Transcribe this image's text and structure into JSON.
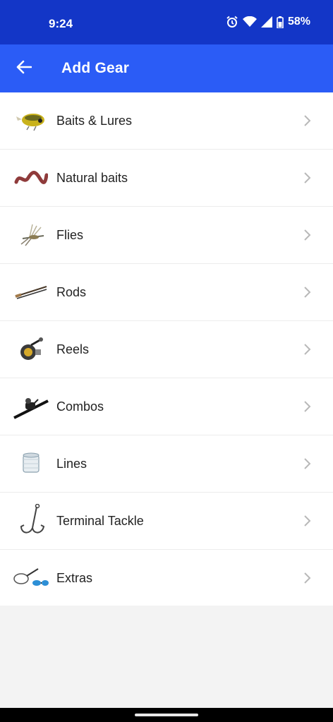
{
  "status": {
    "time": "9:24",
    "battery": "58%"
  },
  "header": {
    "title": "Add Gear",
    "back_icon": "arrow-back-icon"
  },
  "colors": {
    "status_bar": "#1336c7",
    "app_bar": "#2b5cf6",
    "background": "#f3f3f3"
  },
  "categories": [
    {
      "label": "Baits & Lures",
      "icon": "lure-icon"
    },
    {
      "label": "Natural baits",
      "icon": "worm-icon"
    },
    {
      "label": "Flies",
      "icon": "fly-icon"
    },
    {
      "label": "Rods",
      "icon": "rod-icon"
    },
    {
      "label": "Reels",
      "icon": "reel-icon"
    },
    {
      "label": "Combos",
      "icon": "combo-icon"
    },
    {
      "label": "Lines",
      "icon": "line-spool-icon"
    },
    {
      "label": "Terminal Tackle",
      "icon": "hook-icon"
    },
    {
      "label": "Extras",
      "icon": "extras-icon"
    }
  ]
}
